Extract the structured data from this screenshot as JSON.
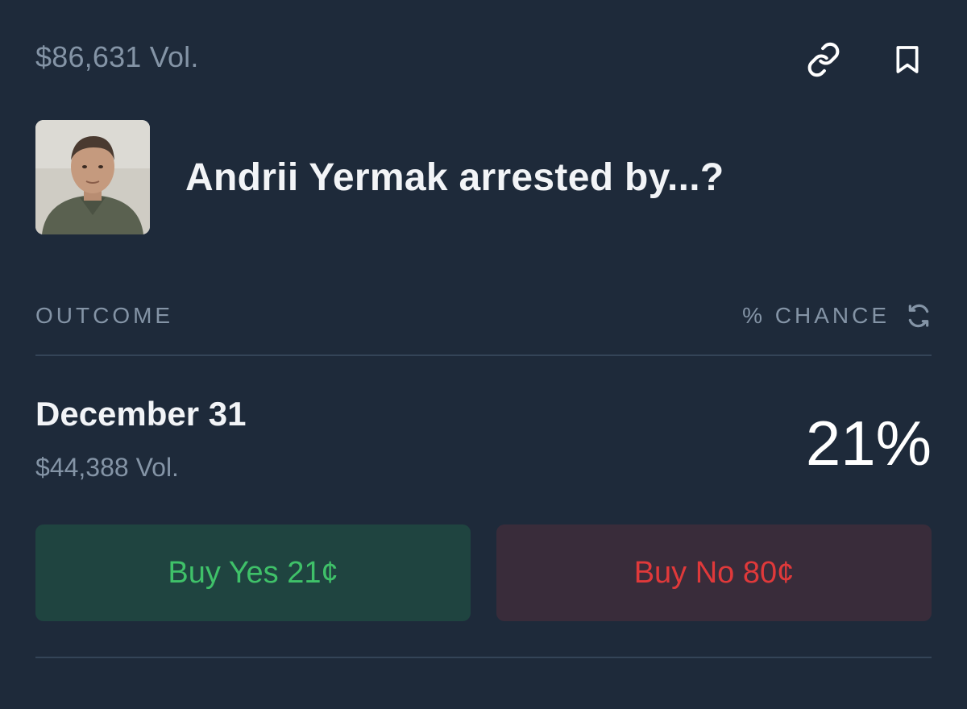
{
  "header": {
    "total_volume": "$86,631 Vol.",
    "icons": [
      "link-icon",
      "bookmark-icon"
    ]
  },
  "market": {
    "title": "Andrii Yermak arrested by...?"
  },
  "table": {
    "outcome_header": "OUTCOME",
    "chance_header": "% CHANCE"
  },
  "outcome": {
    "name": "December 31",
    "volume": "$44,388 Vol.",
    "chance": "21%",
    "buy_yes_label": "Buy Yes 21¢",
    "buy_no_label": "Buy No 80¢"
  },
  "colors": {
    "background": "#1e2a3a",
    "muted_text": "#8494a6",
    "yes_green": "#3fc169",
    "no_red": "#e0393a"
  }
}
